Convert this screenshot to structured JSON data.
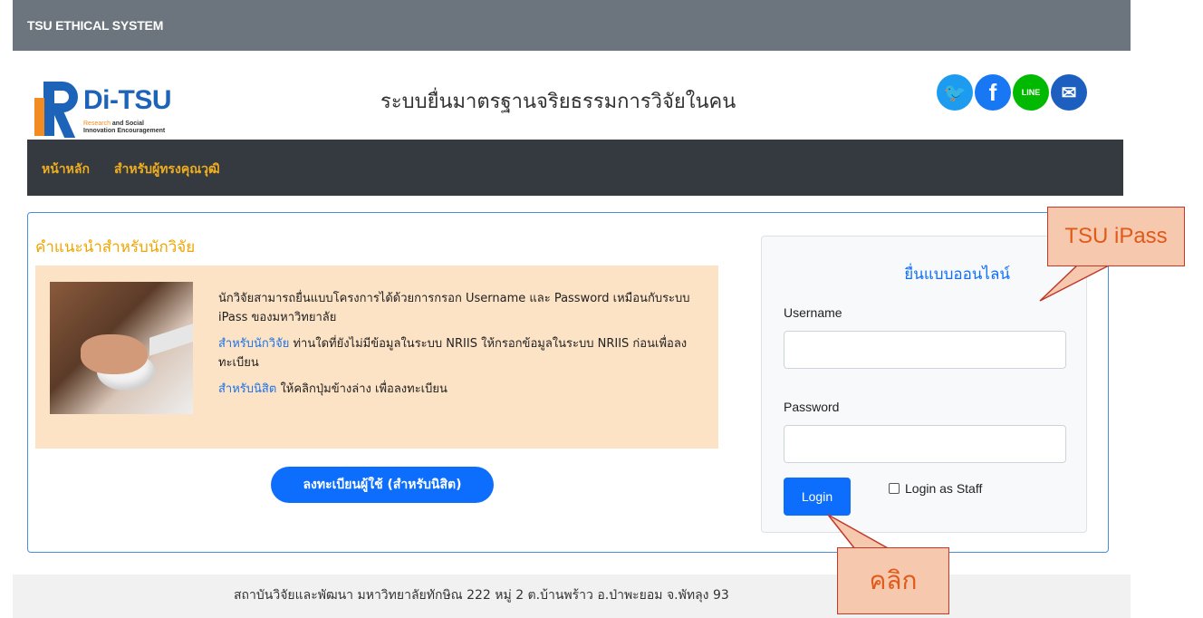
{
  "topbar": {
    "system_name": "TSU ETHICAL SYSTEM"
  },
  "logo": {
    "name_di": "Di",
    "name_dash": "-",
    "name_tsu": "TSU",
    "sub_line1_orange": "Research",
    "sub_line1_rest": " and Social",
    "sub_line2": "Innovation Encouragement"
  },
  "header": {
    "title": "ระบบยื่นมาตรฐานจริยธรรมการวิจัยในคน"
  },
  "socials": [
    {
      "name": "twitter-icon",
      "glyph": "🐦",
      "label": ""
    },
    {
      "name": "facebook-icon",
      "glyph": "f",
      "label": ""
    },
    {
      "name": "line-icon",
      "glyph": "LINE",
      "label": ""
    },
    {
      "name": "mail-icon",
      "glyph": "✉",
      "label": ""
    }
  ],
  "nav": {
    "home": "หน้าหลัก",
    "experts": "สำหรับผู้ทรงคุณวุฒิ"
  },
  "guide": {
    "title": "คำแนะนำสำหรับนักวิจัย",
    "p1": "นักวิจัยสามารถยื่นแบบโครงการได้ด้วยการกรอก Username และ Password เหมือนกับระบบ iPass ของมหาวิทยาลัย",
    "p2_link": "สำหรับนักวิจัย",
    "p2_rest": " ท่านใดที่ยังไม่มีข้อมูลในระบบ NRIIS ให้กรอกข้อมูลในระบบ NRIIS ก่อนเพื่อลงทะเบียน",
    "p3_link": "สำหรับนิสิต",
    "p3_rest": " ให้คลิกปุ่มข้างล่าง เพื่อลงทะเบียน",
    "register_button": "ลงทะเบียนผู้ใช้ (สำหรับนิสิต)"
  },
  "login": {
    "title": "ยื่นแบบออนไลน์",
    "username_label": "Username",
    "username_value": "",
    "password_label": "Password",
    "password_value": "",
    "login_button": "Login",
    "staff_checkbox_label": "Login as Staff",
    "staff_checked": false
  },
  "footer": {
    "text": "สถาบันวิจัยและพัฒนา มหาวิทยาลัยทักษิณ 222 หมู่ 2 ต.บ้านพร้าว อ.ป่าพะยอม จ.พัทลุง 93"
  },
  "annotations": {
    "ipass_callout": "TSU iPass",
    "click_callout": "คลิก"
  }
}
